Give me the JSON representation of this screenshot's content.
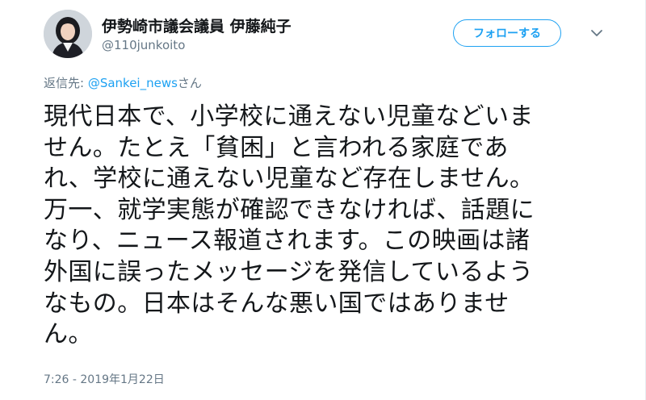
{
  "author": {
    "display_name": "伊勢崎市議会議員 伊藤純子",
    "handle": "@110junkoito"
  },
  "follow_button": {
    "label": "フォローする"
  },
  "menu": {
    "icon": "chevron-down-icon"
  },
  "reply": {
    "prefix": "返信先: ",
    "mention": "@Sankei_news",
    "suffix": "さん"
  },
  "tweet": {
    "lines": [
      "現代日本で、小学校に通えない児童などいま",
      "せん。たとえ「貧困」と言われる家庭であ",
      "れ、学校に通えない児童など存在しません。",
      "万一、就学実態が確認できなければ、話題に",
      "なり、ニュース報道されます。この映画は諸",
      "外国に誤ったメッセージを発信しているよう",
      "なもの。日本はそんな悪い国ではありませ",
      "ん。"
    ],
    "timestamp": "7:26 - 2019年1月22日"
  },
  "colors": {
    "accent": "#1da1f2",
    "text": "#14171a",
    "secondary": "#657786"
  }
}
